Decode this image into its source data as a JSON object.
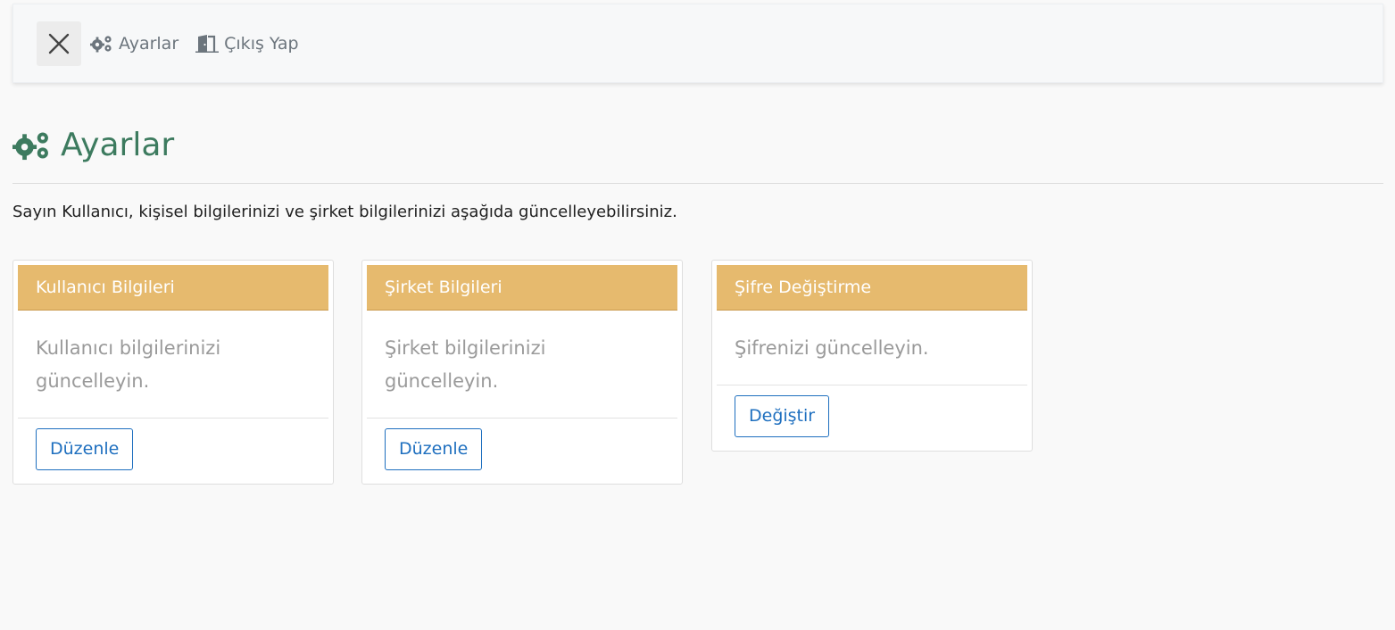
{
  "topbar": {
    "close_icon": "close-icon",
    "settings_label": "Ayarlar",
    "settings_icon": "gears-icon",
    "logout_label": "Çıkış Yap",
    "logout_icon": "door-exit-icon"
  },
  "page": {
    "title": "Ayarlar",
    "title_icon": "gears-icon",
    "intro": "Sayın Kullanıcı, kişisel bilgilerinizi ve şirket bilgilerinizi aşağıda güncelleyebilirsiniz."
  },
  "cards": [
    {
      "header": "Kullanıcı Bilgileri",
      "body_line1": "Kullanıcı bilgilerinizi",
      "body_line2": "güncelleyin.",
      "button": "Düzenle"
    },
    {
      "header": "Şirket Bilgileri",
      "body_line1": "Şirket bilgilerinizi",
      "body_line2": "güncelleyin.",
      "button": "Düzenle"
    },
    {
      "header": "Şifre Değiştirme",
      "body_line1": "Şifrenizi güncelleyin.",
      "button": "Değiştir"
    }
  ],
  "colors": {
    "accent_green": "#3d7b5f",
    "card_header": "#e6ba6e",
    "button_blue": "#1e6fbf"
  }
}
